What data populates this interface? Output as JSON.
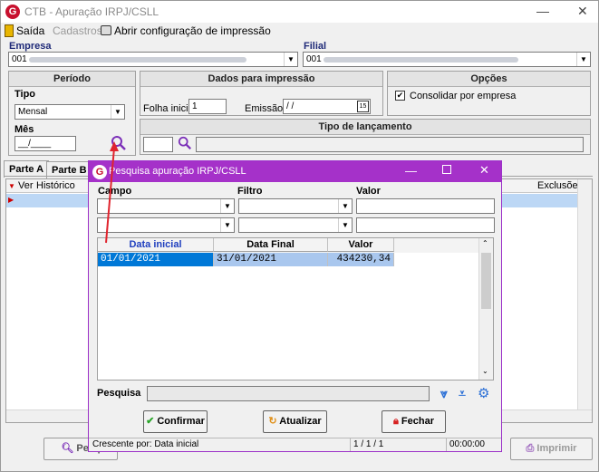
{
  "window": {
    "title": "CTB - Apuração IRPJ/CSLL",
    "minimize": "—",
    "close": "✕"
  },
  "toolbar": {
    "exit_label": "Saída",
    "registers_label": "Cadastros",
    "print_config_label": "Abrir configuração de impressão"
  },
  "empresa": {
    "label": "Empresa",
    "code": "001"
  },
  "filial": {
    "label": "Filial",
    "code": "001"
  },
  "periodo": {
    "title": "Período",
    "tipo_label": "Tipo",
    "tipo_value": "Mensal",
    "mes_label": "Mês",
    "mes_value": "__/____"
  },
  "dados_impressao": {
    "title": "Dados para impressão",
    "folha_label": "Folha inicial",
    "folha_value": "1",
    "emissao_label": "Emissão",
    "emissao_value": " / /",
    "calendar_day": "15"
  },
  "opcoes": {
    "title": "Opções",
    "consolidar_label": "Consolidar por empresa",
    "consolidar_checked": true
  },
  "tipo_lancamento": {
    "title": "Tipo de lançamento"
  },
  "tabs": [
    {
      "label": "Parte A"
    },
    {
      "label": "Parte B"
    }
  ],
  "main_grid": {
    "columns": [
      "Ver",
      "Histórico",
      "Exclusões"
    ]
  },
  "bottom_buttons": {
    "pesquisar": "Pesq",
    "imprimir": "Imprimir"
  },
  "dialog": {
    "title": "Pesquisa apuração IRPJ/CSLL",
    "filter_headers": [
      "Campo",
      "Filtro",
      "Valor"
    ],
    "columns": [
      "Data inicial",
      "Data Final",
      "Valor apurado"
    ],
    "rows": [
      {
        "data_inicial": "01/01/2021",
        "data_final": "31/01/2021",
        "valor": "434230,34"
      }
    ],
    "pesquisa_label": "Pesquisa",
    "buttons": {
      "confirmar": "Confirmar",
      "atualizar": "Atualizar",
      "fechar": "Fechar"
    },
    "status": {
      "sort": "Crescente por: Data inicial",
      "records": "1 / 1 / 1",
      "time": "00:00:00"
    }
  },
  "colors": {
    "accent_purple": "#a531c9",
    "selection_blue": "#0078d7",
    "header_navy": "#1f2a78",
    "arrow_red": "#e0242e"
  }
}
